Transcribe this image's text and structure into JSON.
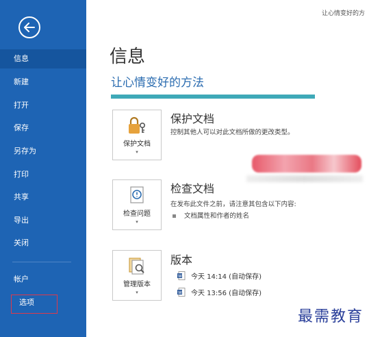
{
  "window": {
    "doc_title": "让心情变好的方"
  },
  "nav": {
    "back_icon": "arrow-left-icon",
    "items": [
      {
        "label": "信息",
        "active": true
      },
      {
        "label": "新建"
      },
      {
        "label": "打开"
      },
      {
        "label": "保存"
      },
      {
        "label": "另存为"
      },
      {
        "label": "打印"
      },
      {
        "label": "共享"
      },
      {
        "label": "导出"
      },
      {
        "label": "关闭"
      }
    ],
    "account": "帐户",
    "options": "选项"
  },
  "main": {
    "page_title": "信息",
    "document_name": "让心情变好的方法",
    "protect": {
      "tile_label": "保护文档",
      "title": "保护文档",
      "desc": "控制其他人可以对此文档所做的更改类型。",
      "icon": "lock-key-icon"
    },
    "inspect": {
      "tile_label": "检查问题",
      "title": "检查文档",
      "desc": "在发布此文件之前，请注意其包含以下内容:",
      "bullet": "文档属性和作者的姓名",
      "icon": "inspect-document-icon"
    },
    "versions": {
      "tile_label": "管理版本",
      "title": "版本",
      "entries": [
        "今天 14:14 (自动保存)",
        "今天 13:56 (自动保存)"
      ],
      "icon": "manage-versions-icon"
    }
  },
  "watermark": "最需教育",
  "colors": {
    "nav_bg": "#1e64b4",
    "accent": "#2b6cb0",
    "progress": "#3fa9b8",
    "options_outline": "#e0394a"
  }
}
